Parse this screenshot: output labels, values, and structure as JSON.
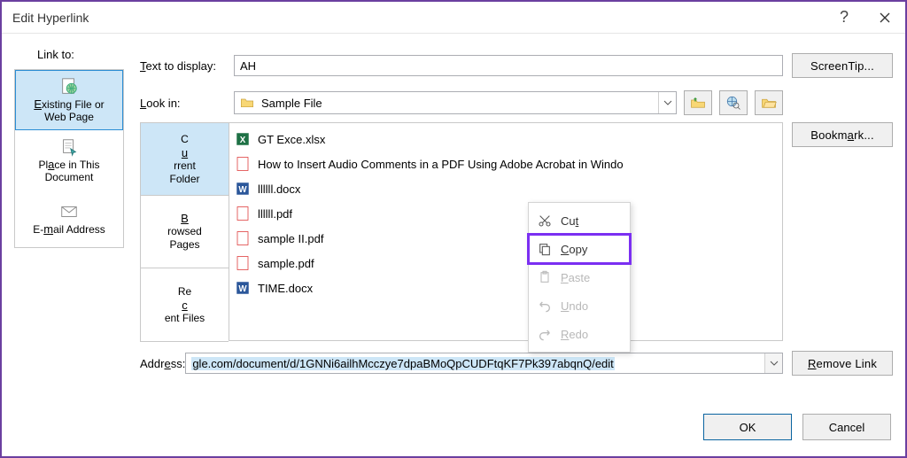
{
  "window": {
    "title": "Edit Hyperlink"
  },
  "link_to_label": "Link to:",
  "side": {
    "existing": "Existing File or\nWeb Page",
    "place": "Place in This\nDocument",
    "email": "E-mail Address"
  },
  "text_display": {
    "label": "Text to display:",
    "value": "AH"
  },
  "screentip_btn": "ScreenTip...",
  "look_in": {
    "label": "Look in:",
    "value": "Sample File"
  },
  "tabs": {
    "current": "Current\nFolder",
    "browsed": "Browsed\nPages",
    "recent": "Recent Files"
  },
  "files": [
    {
      "icon": "excel",
      "name": "GT Exce.xlsx"
    },
    {
      "icon": "pdf",
      "name": "How to Insert Audio Comments in a PDF Using Adobe Acrobat in Windo"
    },
    {
      "icon": "word",
      "name": "llllll.docx"
    },
    {
      "icon": "pdf",
      "name": "llllll.pdf"
    },
    {
      "icon": "pdf",
      "name": "sample II.pdf"
    },
    {
      "icon": "pdf",
      "name": "sample.pdf"
    },
    {
      "icon": "word",
      "name": "TIME.docx"
    }
  ],
  "bookmark_btn": "Bookmark...",
  "address": {
    "label": "Address:",
    "value": "gle.com/document/d/1GNNi6ailhMcczye7dpaBMoQpCUDFtqKF7Pk397abqnQ/edit"
  },
  "remove_btn": "Remove Link",
  "ok_btn": "OK",
  "cancel_btn": "Cancel",
  "ctx": {
    "cut": "Cut",
    "copy": "Copy",
    "paste": "Paste",
    "undo": "Undo",
    "redo": "Redo"
  }
}
